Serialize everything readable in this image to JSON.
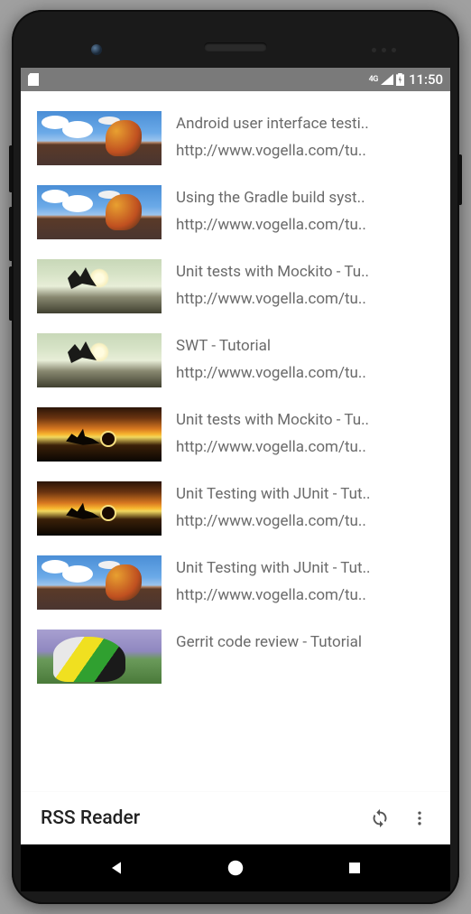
{
  "status": {
    "network_label": "4G",
    "time": "11:50"
  },
  "feed": {
    "items": [
      {
        "title": "Android user interface testi..",
        "url": "http://www.vogella.com/tu..",
        "thumb": "moto"
      },
      {
        "title": "Using the Gradle build syst..",
        "url": "http://www.vogella.com/tu..",
        "thumb": "moto"
      },
      {
        "title": "Unit tests with Mockito - Tu..",
        "url": "http://www.vogella.com/tu..",
        "thumb": "jump"
      },
      {
        "title": "SWT - Tutorial",
        "url": "http://www.vogella.com/tu..",
        "thumb": "jump"
      },
      {
        "title": "Unit tests with Mockito - Tu..",
        "url": "http://www.vogella.com/tu..",
        "thumb": "sunset"
      },
      {
        "title": "Unit Testing with JUnit - Tut..",
        "url": "http://www.vogella.com/tu..",
        "thumb": "sunset"
      },
      {
        "title": "Unit Testing with JUnit - Tut..",
        "url": "http://www.vogella.com/tu..",
        "thumb": "moto"
      },
      {
        "title": "Gerrit code review - Tutorial",
        "url": "",
        "thumb": "gerrit"
      }
    ]
  },
  "appbar": {
    "title": "RSS Reader"
  }
}
